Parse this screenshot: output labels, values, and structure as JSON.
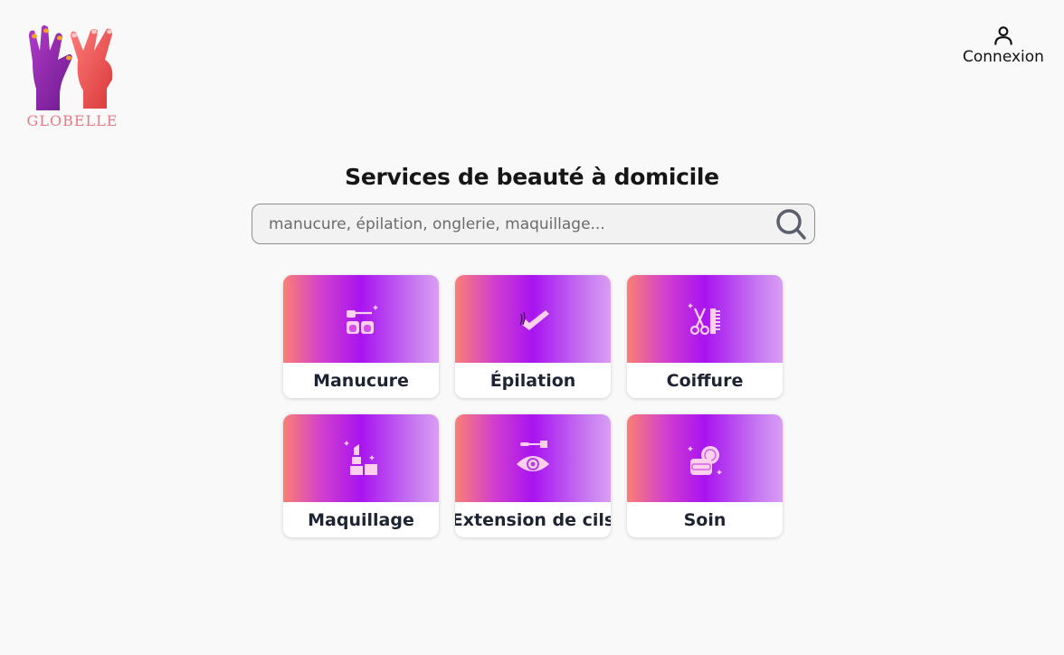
{
  "brand": {
    "name": "GLOBELLE"
  },
  "header": {
    "login_label": "Connexion",
    "login_icon": "user-icon"
  },
  "main": {
    "title": "Services de beauté à domicile",
    "search": {
      "placeholder": "manucure, épilation, onglerie, maquillage...",
      "value": "",
      "icon": "search-icon"
    }
  },
  "services": [
    {
      "label": "Manucure",
      "icon": "nail-polish-icon"
    },
    {
      "label": "Épilation",
      "icon": "wax-strip-icon"
    },
    {
      "label": "Coiffure",
      "icon": "scissors-comb-icon"
    },
    {
      "label": "Maquillage",
      "icon": "lipstick-icon"
    },
    {
      "label": "Extension de cils",
      "icon": "eyelash-icon"
    },
    {
      "label": "Soin",
      "icon": "skincare-cream-icon"
    }
  ],
  "colors": {
    "background": "#f9f9f9",
    "gradient_start": "#fa7f74",
    "gradient_mid": "#a814ef",
    "gradient_end": "#d99ef3",
    "icon_pink": "#ffd0ec",
    "label_text": "#1f2433"
  }
}
